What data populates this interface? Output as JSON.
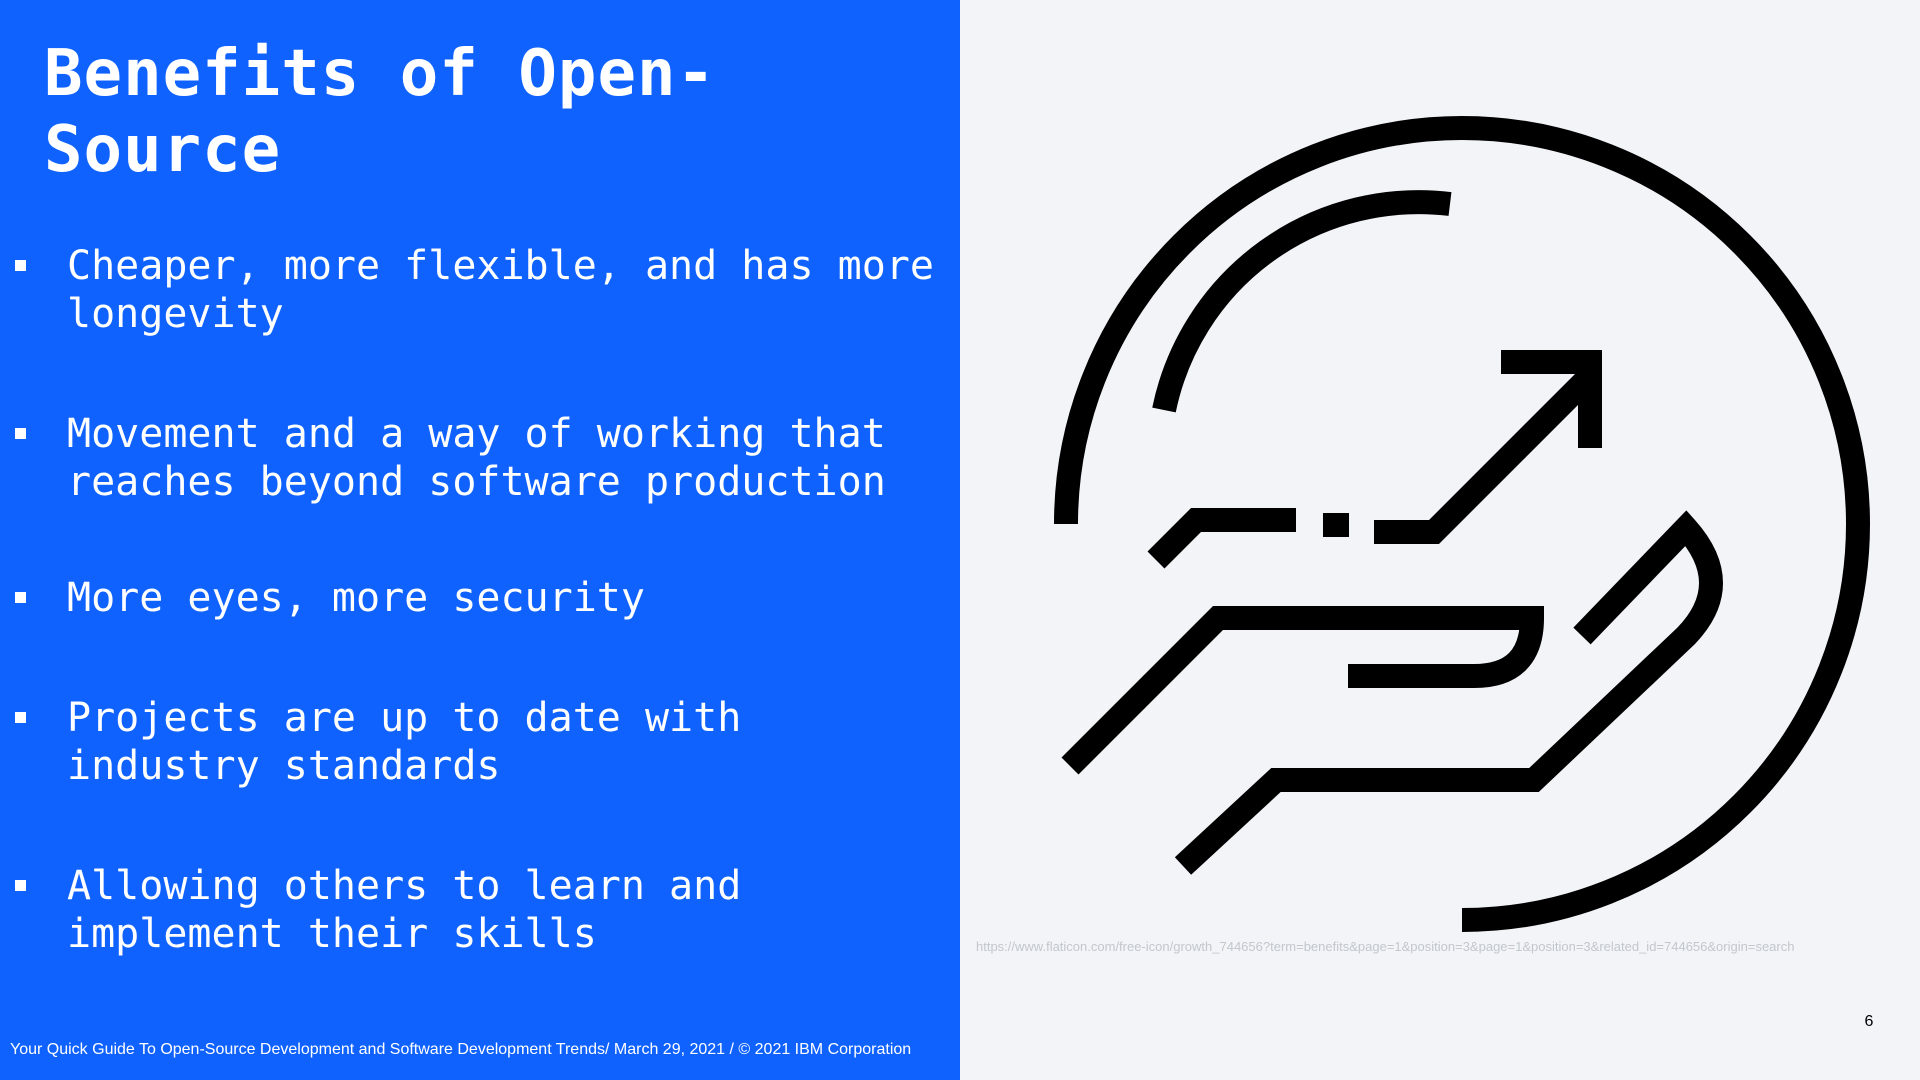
{
  "slide": {
    "title": "Benefits of Open-\nSource",
    "bullets": [
      "Cheaper, more flexible, and has more\nlongevity",
      "Movement and a way of working that\nreaches beyond software production",
      "More eyes, more security",
      "Projects are up to date with\nindustry standards",
      "Allowing others to learn and\nimplement their skills"
    ],
    "footer": "Your Quick Guide To Open-Source Development and Software Development Trends/ March 29,  2021 / © 2021 IBM Corporation",
    "image_source": "https://www.flaticon.com/free-icon/growth_744656?term=benefits&page=1&position=3&page=1&position=3&related_id=744656&origin=search",
    "page_number": "6",
    "icon": "growth-hand-arrow-icon"
  },
  "colors": {
    "primary_blue": "#0f62fe",
    "background": "#f2f4f8",
    "text_on_blue": "#ffffff",
    "icon_stroke": "#000000",
    "link_text": "#c1c7cd"
  }
}
